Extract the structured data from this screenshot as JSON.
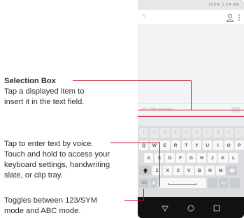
{
  "annotations": {
    "selection_box": {
      "title": "Selection Box",
      "lines": [
        "Tap a displayed item to",
        "insert it in the text field."
      ]
    },
    "voice": {
      "lines": [
        "Tap to enter text by voice.",
        "Touch and hold to access your",
        "keyboard settings, handwriting",
        "slate, or clip tray."
      ]
    },
    "toggle": {
      "lines": [
        "Toggles between 123/SYM",
        "mode and ABC mode."
      ]
    }
  },
  "phone": {
    "status": {
      "battery_text": "100%",
      "time": "1:04 AM"
    },
    "to_label": "To",
    "compose": {
      "attach_label": "ATT",
      "placeholder": "Enter message"
    },
    "keyboard": {
      "number_row": [
        "1",
        "2",
        "3",
        "4",
        "5",
        "6",
        "7",
        "8",
        "9",
        "0"
      ],
      "row1": [
        "Q",
        "W",
        "E",
        "R",
        "T",
        "Y",
        "U",
        "I",
        "O",
        "P"
      ],
      "row2": [
        "A",
        "S",
        "D",
        "F",
        "G",
        "H",
        "J",
        "K",
        "L"
      ],
      "row3": [
        "Z",
        "X",
        "C",
        "V",
        "B",
        "N",
        "M"
      ],
      "sym_label": "123",
      "shift_icon": "shift-arrow-icon",
      "mic_icon": "microphone-icon",
      "backspace_icon": "backspace-icon",
      "enter_icon": "enter-icon"
    },
    "nav_icons": [
      "back-triangle-icon",
      "home-circle-icon",
      "recents-square-icon"
    ]
  },
  "colors": {
    "leader_line": "#c8102e",
    "keyboard_bg": "#dadcdf",
    "nav_bar": "#111111"
  }
}
